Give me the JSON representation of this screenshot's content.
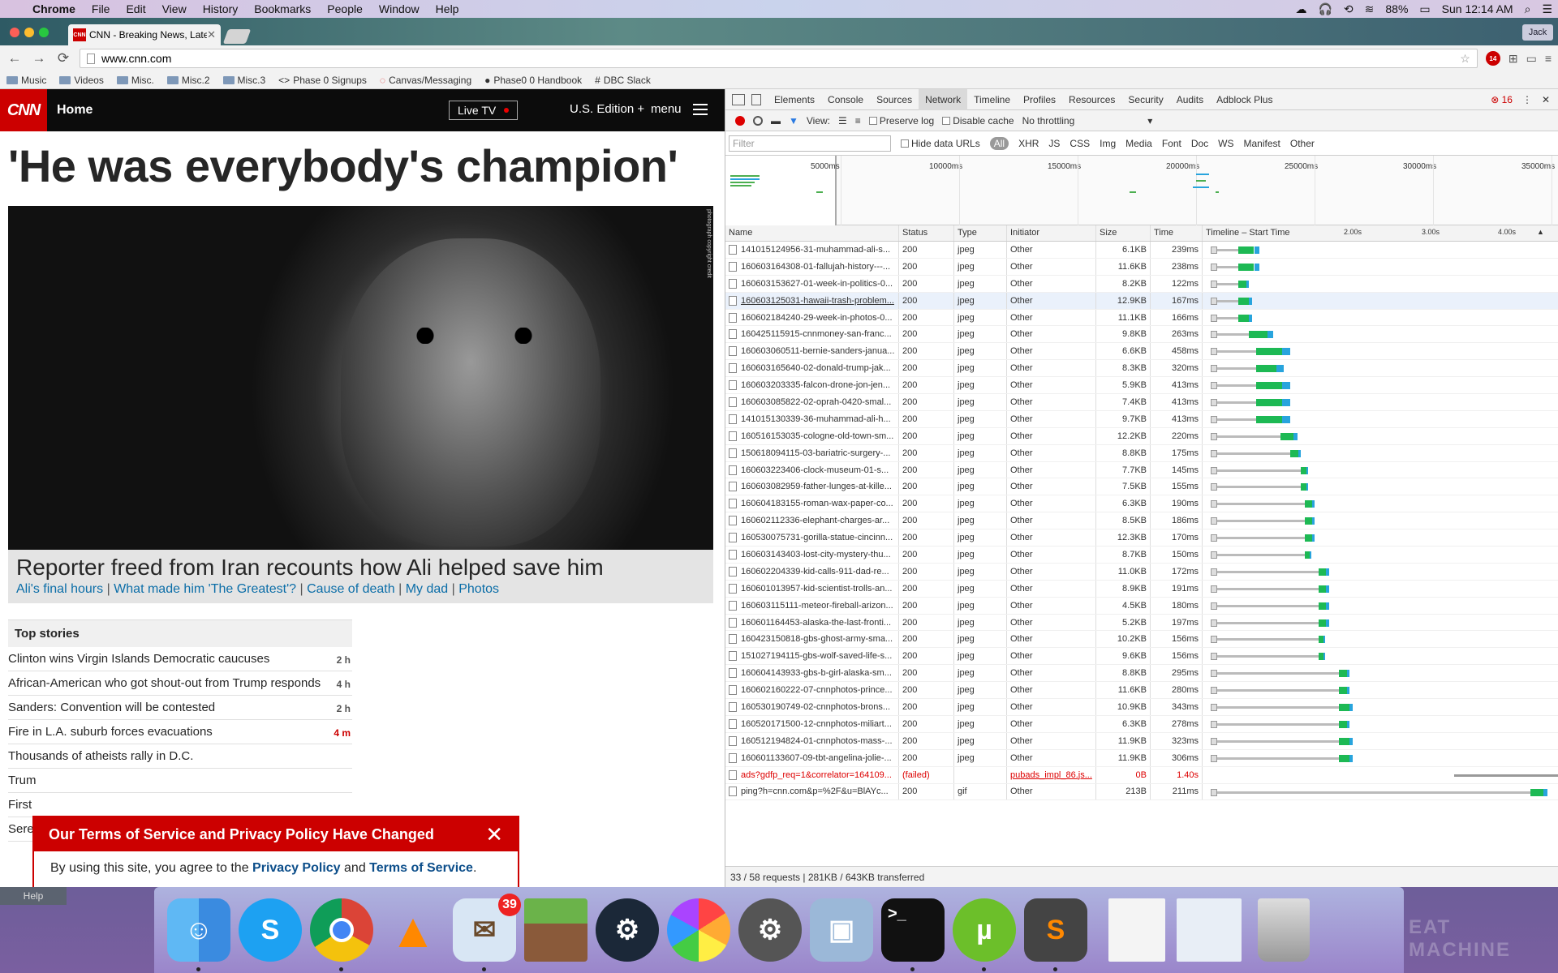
{
  "menubar": {
    "items": [
      "Chrome",
      "File",
      "Edit",
      "View",
      "History",
      "Bookmarks",
      "People",
      "Window",
      "Help"
    ],
    "battery": "88%",
    "clock": "Sun 12:14 AM",
    "user": "Jack"
  },
  "tab": {
    "title": "CNN - Breaking News, Latest",
    "favicon": "CNN"
  },
  "address": {
    "url": "www.cnn.com"
  },
  "abp_count": "14",
  "bookmarks": [
    "Music",
    "Videos",
    "Misc.",
    "Misc.2",
    "Misc.3",
    "Phase 0 Signups",
    "Canvas/Messaging",
    "Phase0 0 Handbook",
    "DBC Slack"
  ],
  "cnn": {
    "logo": "CNN",
    "home": "Home",
    "live_tv": "Live TV",
    "edition": "U.S. Edition +",
    "menu": "menu",
    "headline": "'He was everybody's champion'",
    "photo_credit": "photograph copyright credit",
    "caption_title": "Reporter freed from Iran recounts how Ali helped save him",
    "caption_links": [
      "Ali's final hours",
      "What made him 'The Greatest'?",
      "Cause of death",
      "My dad",
      "Photos"
    ],
    "top_stories_title": "Top stories",
    "stories": [
      {
        "title": "Clinton wins Virgin Islands Democratic caucuses",
        "time": "2 h",
        "fresh": false
      },
      {
        "title": "African-American who got shout-out from Trump responds",
        "time": "4 h",
        "fresh": false
      },
      {
        "title": "Sanders: Convention will be contested",
        "time": "2 h",
        "fresh": false
      },
      {
        "title": "Fire in L.A. suburb forces evacuations",
        "time": "4 m",
        "fresh": true
      },
      {
        "title": "Thousands of atheists rally in D.C.",
        "time": "",
        "fresh": false
      },
      {
        "title": "Trum",
        "time": "",
        "fresh": false
      },
      {
        "title": "First",
        "time": "",
        "fresh": false
      },
      {
        "title": "Sere",
        "time": "",
        "fresh": false
      }
    ],
    "tos_title": "Our Terms of Service and Privacy Policy Have Changed",
    "tos_prefix": "By using this site, you agree to the",
    "tos_privacy": "Privacy Policy",
    "tos_and": "and",
    "tos_terms": "Terms of Service",
    "tos_suffix": ".",
    "help": "Help"
  },
  "devtools": {
    "tabs": [
      "Elements",
      "Console",
      "Sources",
      "Network",
      "Timeline",
      "Profiles",
      "Resources",
      "Security",
      "Audits",
      "Adblock Plus"
    ],
    "active_tab": "Network",
    "error_count": "16",
    "view_label": "View:",
    "preserve_log": "Preserve log",
    "disable_cache": "Disable cache",
    "throttling": "No throttling",
    "filter_placeholder": "Filter",
    "hide_data_urls": "Hide data URLs",
    "types": [
      "All",
      "XHR",
      "JS",
      "CSS",
      "Img",
      "Media",
      "Font",
      "Doc",
      "WS",
      "Manifest",
      "Other"
    ],
    "overview_ticks": [
      "5000ms",
      "10000ms",
      "15000ms",
      "20000ms",
      "25000ms",
      "30000ms",
      "35000ms"
    ],
    "columns": [
      "Name",
      "Status",
      "Type",
      "Initiator",
      "Size",
      "Time",
      "Timeline – Start Time"
    ],
    "timeline_ticks": [
      "2.00s",
      "3.00s",
      "4.00s"
    ],
    "rows": [
      {
        "name": "141015124956-31-muhammad-ali-s...",
        "status": "200",
        "type": "jpeg",
        "init": "Other",
        "size": "6.1KB",
        "time": "239ms",
        "start": 0.08,
        "dur": 0.06
      },
      {
        "name": "160603164308-01-fallujah-history---...",
        "status": "200",
        "type": "jpeg",
        "init": "Other",
        "size": "11.6KB",
        "time": "238ms",
        "start": 0.08,
        "dur": 0.06
      },
      {
        "name": "160603153627-01-week-in-politics-0...",
        "status": "200",
        "type": "jpeg",
        "init": "Other",
        "size": "8.2KB",
        "time": "122ms",
        "start": 0.08,
        "dur": 0.03
      },
      {
        "name": "160603125031-hawaii-trash-problem...",
        "status": "200",
        "type": "jpeg",
        "init": "Other",
        "size": "12.9KB",
        "time": "167ms",
        "start": 0.08,
        "dur": 0.04,
        "hl": true
      },
      {
        "name": "160602184240-29-week-in-photos-0...",
        "status": "200",
        "type": "jpeg",
        "init": "Other",
        "size": "11.1KB",
        "time": "166ms",
        "start": 0.08,
        "dur": 0.04
      },
      {
        "name": "160425115915-cnnmoney-san-franc...",
        "status": "200",
        "type": "jpeg",
        "init": "Other",
        "size": "9.8KB",
        "time": "263ms",
        "start": 0.11,
        "dur": 0.07
      },
      {
        "name": "160603060511-bernie-sanders-janua...",
        "status": "200",
        "type": "jpeg",
        "init": "Other",
        "size": "6.6KB",
        "time": "458ms",
        "start": 0.13,
        "dur": 0.1
      },
      {
        "name": "160603165640-02-donald-trump-jak...",
        "status": "200",
        "type": "jpeg",
        "init": "Other",
        "size": "8.3KB",
        "time": "320ms",
        "start": 0.13,
        "dur": 0.08
      },
      {
        "name": "160603203335-falcon-drone-jon-jen...",
        "status": "200",
        "type": "jpeg",
        "init": "Other",
        "size": "5.9KB",
        "time": "413ms",
        "start": 0.13,
        "dur": 0.1
      },
      {
        "name": "160603085822-02-oprah-0420-smal...",
        "status": "200",
        "type": "jpeg",
        "init": "Other",
        "size": "7.4KB",
        "time": "413ms",
        "start": 0.13,
        "dur": 0.1
      },
      {
        "name": "141015130339-36-muhammad-ali-h...",
        "status": "200",
        "type": "jpeg",
        "init": "Other",
        "size": "9.7KB",
        "time": "413ms",
        "start": 0.13,
        "dur": 0.1
      },
      {
        "name": "160516153035-cologne-old-town-sm...",
        "status": "200",
        "type": "jpeg",
        "init": "Other",
        "size": "12.2KB",
        "time": "220ms",
        "start": 0.2,
        "dur": 0.05
      },
      {
        "name": "150618094115-03-bariatric-surgery-...",
        "status": "200",
        "type": "jpeg",
        "init": "Other",
        "size": "8.8KB",
        "time": "175ms",
        "start": 0.23,
        "dur": 0.03
      },
      {
        "name": "160603223406-clock-museum-01-s...",
        "status": "200",
        "type": "jpeg",
        "init": "Other",
        "size": "7.7KB",
        "time": "145ms",
        "start": 0.26,
        "dur": 0.02
      },
      {
        "name": "160603082959-father-lunges-at-kille...",
        "status": "200",
        "type": "jpeg",
        "init": "Other",
        "size": "7.5KB",
        "time": "155ms",
        "start": 0.26,
        "dur": 0.02
      },
      {
        "name": "160604183155-roman-wax-paper-co...",
        "status": "200",
        "type": "jpeg",
        "init": "Other",
        "size": "6.3KB",
        "time": "190ms",
        "start": 0.27,
        "dur": 0.03
      },
      {
        "name": "160602112336-elephant-charges-ar...",
        "status": "200",
        "type": "jpeg",
        "init": "Other",
        "size": "8.5KB",
        "time": "186ms",
        "start": 0.27,
        "dur": 0.03
      },
      {
        "name": "160530075731-gorilla-statue-cincinn...",
        "status": "200",
        "type": "jpeg",
        "init": "Other",
        "size": "12.3KB",
        "time": "170ms",
        "start": 0.27,
        "dur": 0.03
      },
      {
        "name": "160603143403-lost-city-mystery-thu...",
        "status": "200",
        "type": "jpeg",
        "init": "Other",
        "size": "8.7KB",
        "time": "150ms",
        "start": 0.27,
        "dur": 0.02
      },
      {
        "name": "160602204339-kid-calls-911-dad-re...",
        "status": "200",
        "type": "jpeg",
        "init": "Other",
        "size": "11.0KB",
        "time": "172ms",
        "start": 0.31,
        "dur": 0.03
      },
      {
        "name": "160601013957-kid-scientist-trolls-an...",
        "status": "200",
        "type": "jpeg",
        "init": "Other",
        "size": "8.9KB",
        "time": "191ms",
        "start": 0.31,
        "dur": 0.03
      },
      {
        "name": "160603115111-meteor-fireball-arizon...",
        "status": "200",
        "type": "jpeg",
        "init": "Other",
        "size": "4.5KB",
        "time": "180ms",
        "start": 0.31,
        "dur": 0.03
      },
      {
        "name": "160601164453-alaska-the-last-fronti...",
        "status": "200",
        "type": "jpeg",
        "init": "Other",
        "size": "5.2KB",
        "time": "197ms",
        "start": 0.31,
        "dur": 0.03
      },
      {
        "name": "160423150818-gbs-ghost-army-sma...",
        "status": "200",
        "type": "jpeg",
        "init": "Other",
        "size": "10.2KB",
        "time": "156ms",
        "start": 0.31,
        "dur": 0.02
      },
      {
        "name": "151027194115-gbs-wolf-saved-life-s...",
        "status": "200",
        "type": "jpeg",
        "init": "Other",
        "size": "9.6KB",
        "time": "156ms",
        "start": 0.31,
        "dur": 0.02
      },
      {
        "name": "160604143933-gbs-b-girl-alaska-sm...",
        "status": "200",
        "type": "jpeg",
        "init": "Other",
        "size": "8.8KB",
        "time": "295ms",
        "start": 0.37,
        "dur": 0.03
      },
      {
        "name": "160602160222-07-cnnphotos-prince...",
        "status": "200",
        "type": "jpeg",
        "init": "Other",
        "size": "11.6KB",
        "time": "280ms",
        "start": 0.37,
        "dur": 0.03
      },
      {
        "name": "160530190749-02-cnnphotos-brons...",
        "status": "200",
        "type": "jpeg",
        "init": "Other",
        "size": "10.9KB",
        "time": "343ms",
        "start": 0.37,
        "dur": 0.04
      },
      {
        "name": "160520171500-12-cnnphotos-miliart...",
        "status": "200",
        "type": "jpeg",
        "init": "Other",
        "size": "6.3KB",
        "time": "278ms",
        "start": 0.37,
        "dur": 0.03
      },
      {
        "name": "160512194824-01-cnnphotos-mass-...",
        "status": "200",
        "type": "jpeg",
        "init": "Other",
        "size": "11.9KB",
        "time": "323ms",
        "start": 0.37,
        "dur": 0.04
      },
      {
        "name": "160601133607-09-tbt-angelina-jolie-...",
        "status": "200",
        "type": "jpeg",
        "init": "Other",
        "size": "11.9KB",
        "time": "306ms",
        "start": 0.37,
        "dur": 0.04
      },
      {
        "name": "ads?gdfp_req=1&correlator=164109...",
        "status": "(failed)",
        "type": "",
        "init": "pubads_impl_86.js...",
        "size": "0B",
        "time": "1.40s",
        "start": 0.7,
        "dur": 0.3,
        "failed": true
      },
      {
        "name": "ping?h=cnn.com&p=%2F&u=BlAYc...",
        "status": "200",
        "type": "gif",
        "init": "Other",
        "size": "213B",
        "time": "211ms",
        "start": 0.92,
        "dur": 0.05
      }
    ],
    "summary": "33 / 58 requests | 281KB / 643KB transferred"
  },
  "dock": {
    "apps": [
      "Finder",
      "Skype",
      "Chrome",
      "VLC",
      "Mail",
      "Minecraft",
      "Steam",
      "Photos",
      "System Preferences",
      "Preview",
      "Terminal",
      "uTorrent",
      "Sublime Text",
      "Documents",
      "Downloads",
      "Trash"
    ],
    "mail_badge": "39"
  },
  "watermark": "EAT MACHINE"
}
